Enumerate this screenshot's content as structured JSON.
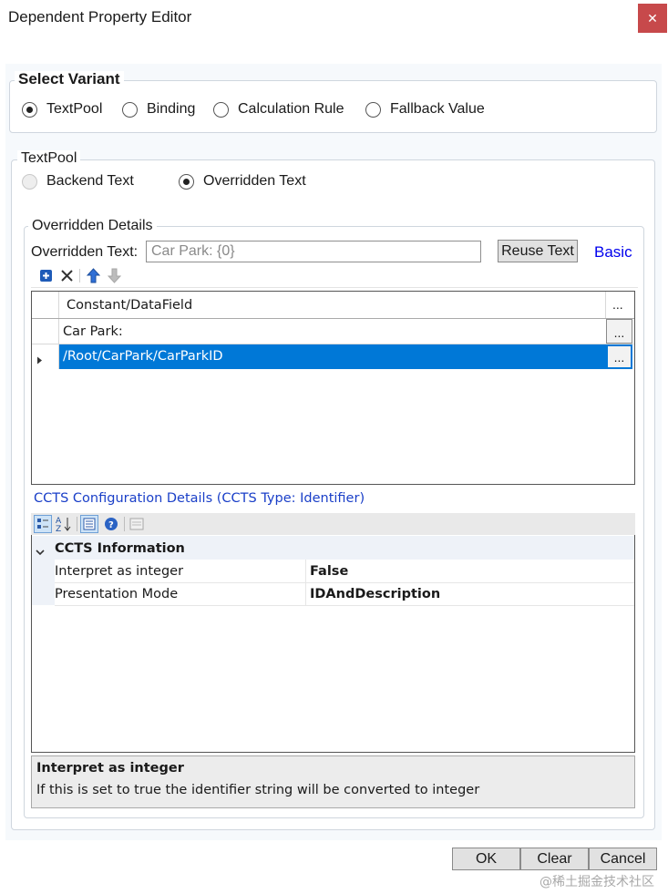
{
  "window": {
    "title": "Dependent Property Editor"
  },
  "select_variant": {
    "legend": "Select Variant",
    "options": [
      "TextPool",
      "Binding",
      "Calculation Rule",
      "Fallback Value"
    ],
    "selected": "TextPool"
  },
  "textpool": {
    "legend": "TextPool",
    "options": [
      "Backend Text",
      "Overridden Text"
    ],
    "selected": "Overridden Text"
  },
  "overridden": {
    "legend": "Overridden Details",
    "label": "Overridden Text:",
    "value": "Car Park: {0}",
    "reuse_button": "Reuse Text",
    "basic_link": "Basic"
  },
  "grid": {
    "header": "Constant/DataField",
    "header_btn": "...",
    "rows": [
      {
        "value": "Car Park:",
        "btn": "...",
        "selected": false
      },
      {
        "value": "/Root/CarPark/CarParkID",
        "btn": "...",
        "selected": true
      }
    ]
  },
  "ccts": {
    "title": "CCTS Configuration Details (CCTS Type: Identifier)",
    "category": "CCTS Information",
    "properties": [
      {
        "name": "Interpret as integer",
        "value": "False"
      },
      {
        "name": "Presentation Mode",
        "value": "IDAndDescription"
      }
    ],
    "help_title": "Interpret as integer",
    "help_text": "If this is set to true the identifier string will be converted to integer"
  },
  "buttons": {
    "ok": "OK",
    "clear": "Clear",
    "cancel": "Cancel"
  },
  "watermark": "@稀土掘金技术社区",
  "colors": {
    "selection": "#0078d7",
    "link": "#0000ee",
    "close": "#c7494b"
  }
}
